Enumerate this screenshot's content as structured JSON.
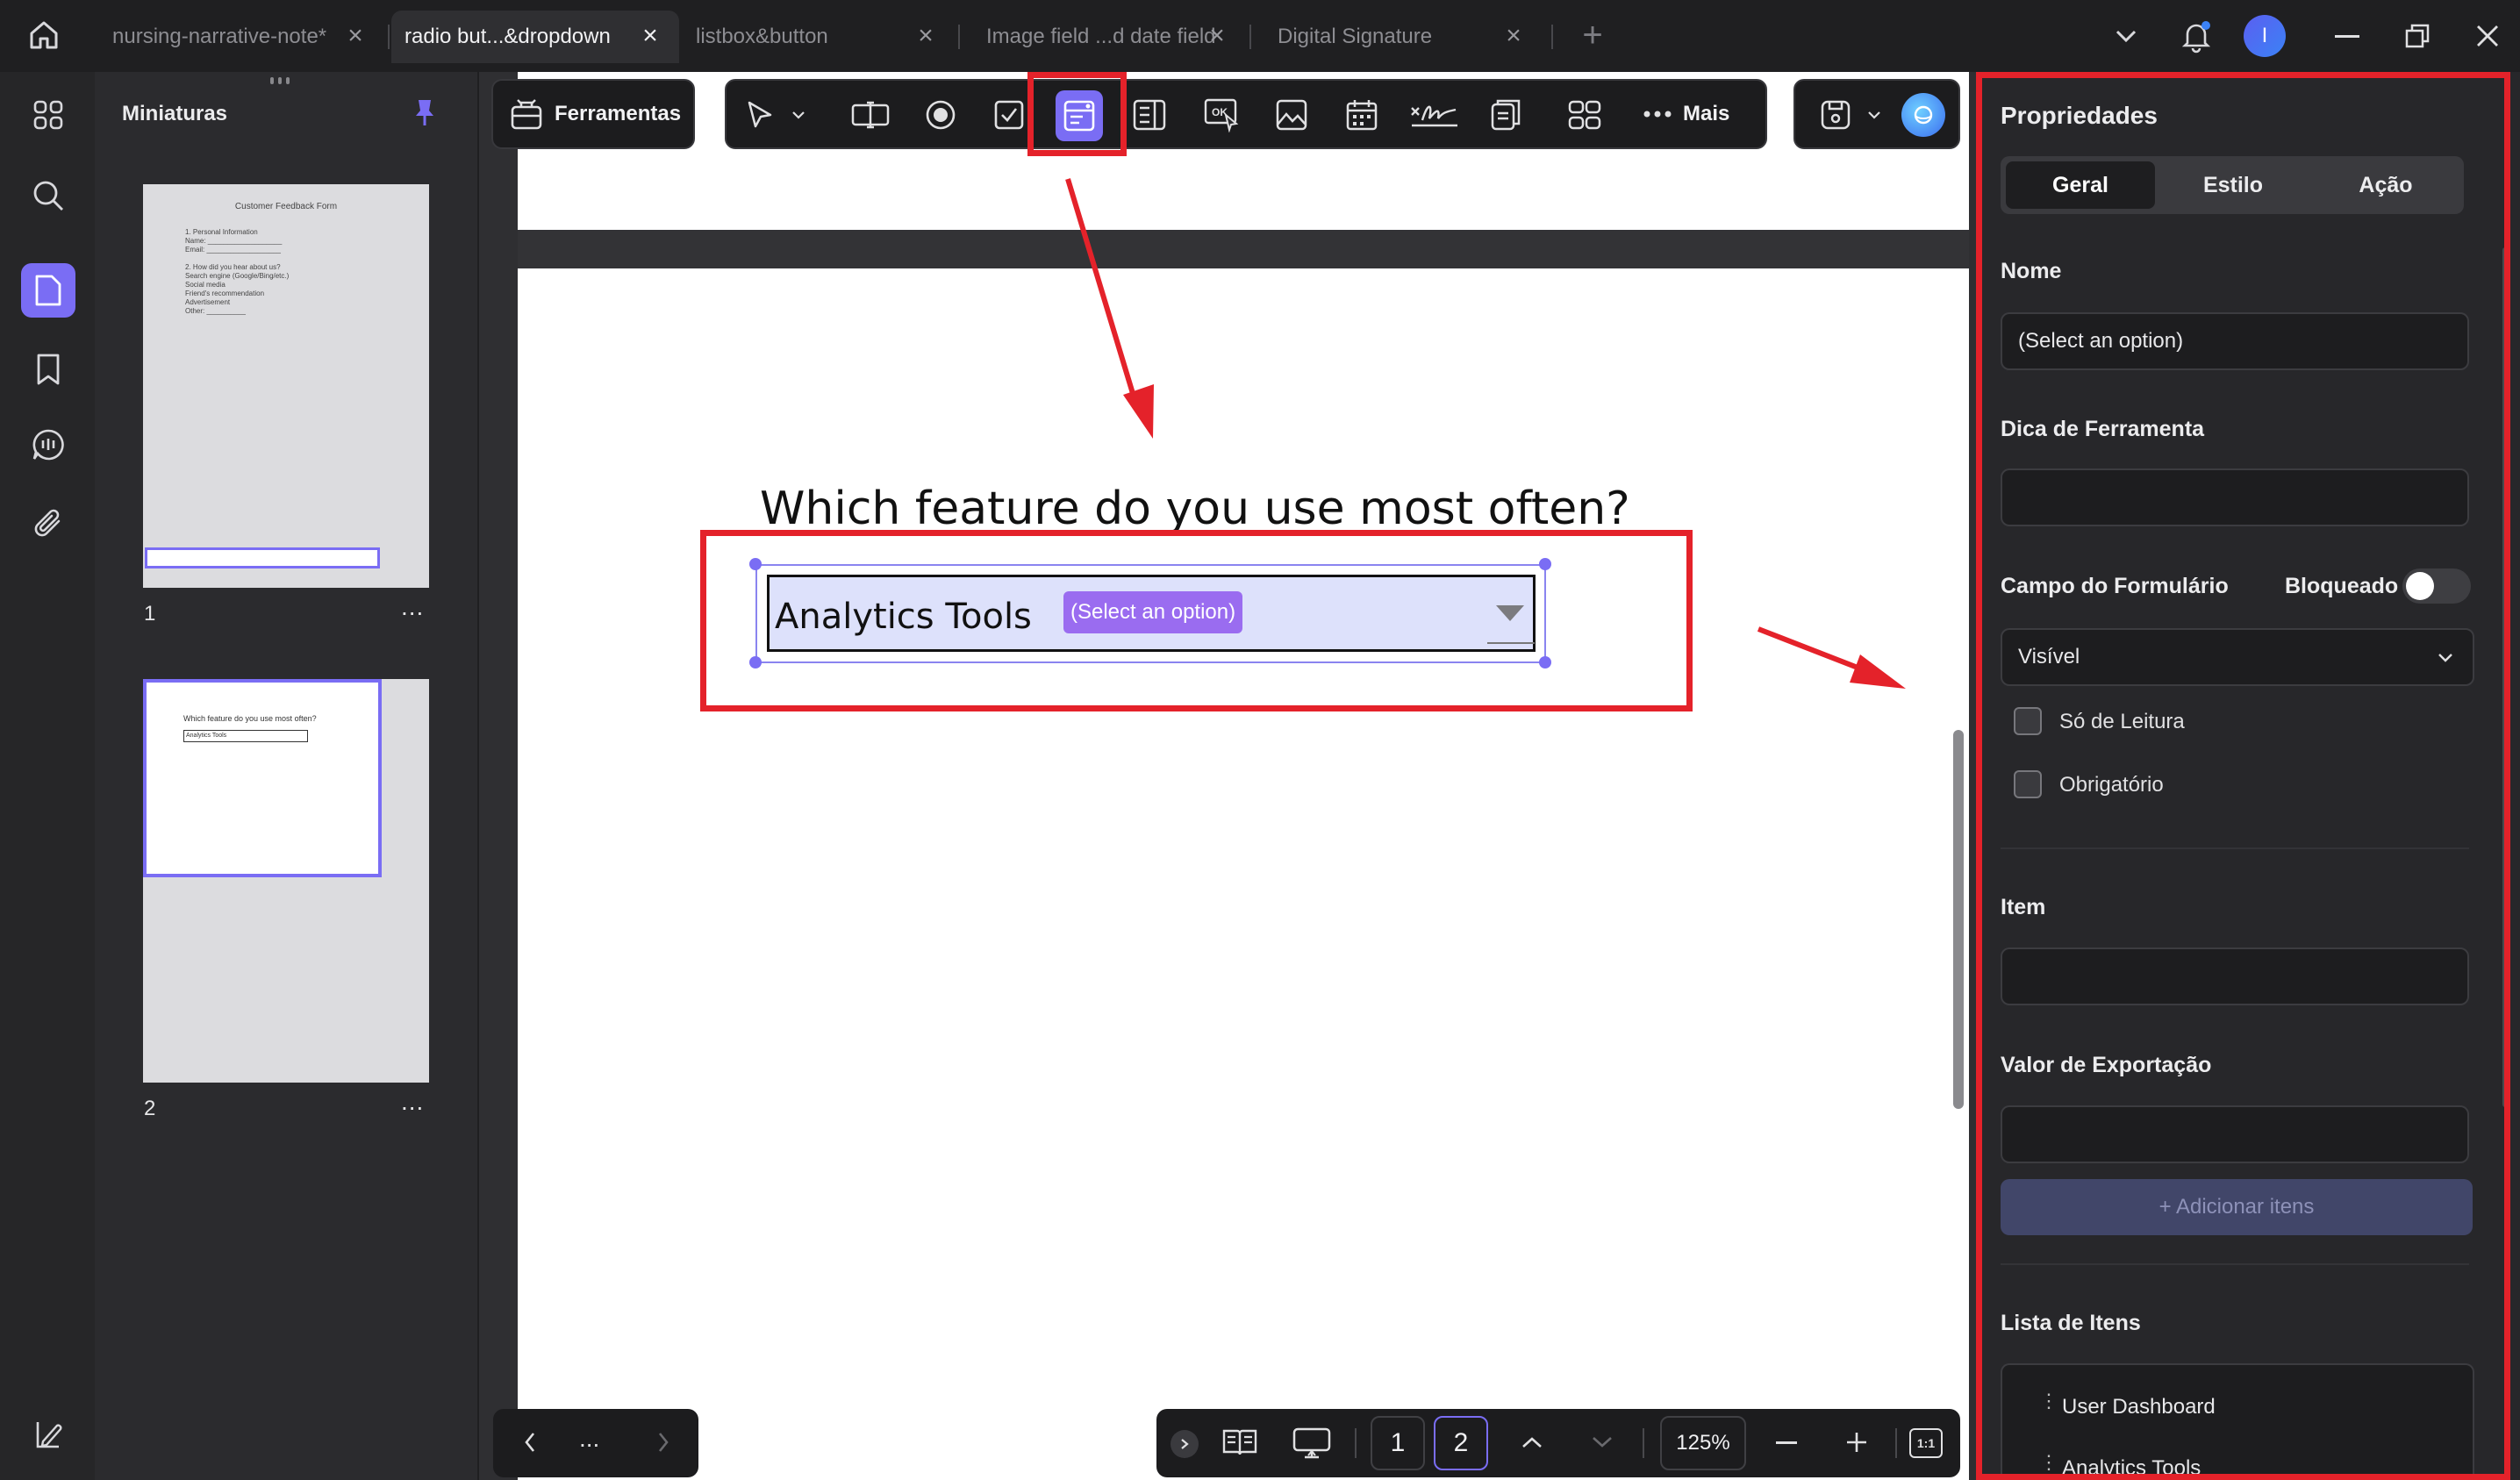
{
  "tabs": [
    {
      "label": "nursing-narrative-note*"
    },
    {
      "label": "radio but...&dropdown"
    },
    {
      "label": "listbox&button"
    },
    {
      "label": "Image field ...d date field"
    },
    {
      "label": "Digital Signature"
    }
  ],
  "thumbnails": {
    "title": "Miniaturas",
    "pages": [
      {
        "number": "1",
        "lines": [
          "Customer Feedback Form",
          "1. Personal Information",
          "Name: ___________________",
          "Email: ___________________",
          "2. How did you hear about us?",
          "Search engine (Google/Bing/etc.)",
          "Social media",
          "Friend's recommendation",
          "Advertisement",
          "Other: __________"
        ]
      },
      {
        "number": "2",
        "lines": [
          "Which feature do you use most often?",
          "Analytics Tools"
        ]
      }
    ],
    "more": "..."
  },
  "toolbar": {
    "tools_label": "Ferramentas",
    "more_label": "Mais"
  },
  "document": {
    "question": "Which feature do you use most often?",
    "dropdown_value": "Analytics Tools",
    "dropdown_tag": "(Select an option)"
  },
  "properties": {
    "title": "Propriedades",
    "tabs": [
      "Geral",
      "Estilo",
      "Ação"
    ],
    "name_label": "Nome",
    "name_value": "(Select an option)",
    "tooltip_label": "Dica de Ferramenta",
    "tooltip_value": "",
    "form_field_label": "Campo do Formulário",
    "locked_label": "Bloqueado",
    "visibility_value": "Visível",
    "readonly_label": "Só de Leitura",
    "required_label": "Obrigatório",
    "item_label": "Item",
    "item_value": "",
    "export_label": "Valor de Exportação",
    "export_value": "",
    "add_items_label": "+ Adicionar itens",
    "items_list_label": "Lista de Itens",
    "items": [
      "User Dashboard",
      "Analytics Tools"
    ]
  },
  "bottombar": {
    "page_current": "1",
    "page_total": "2",
    "zoom": "125%",
    "fit_label": "1:1",
    "more": "..."
  },
  "user": {
    "initial": "I"
  },
  "colors": {
    "accent": "#7a6df4",
    "annotation_red": "#e4222a",
    "dropdown_bg": "#dde1fb"
  }
}
